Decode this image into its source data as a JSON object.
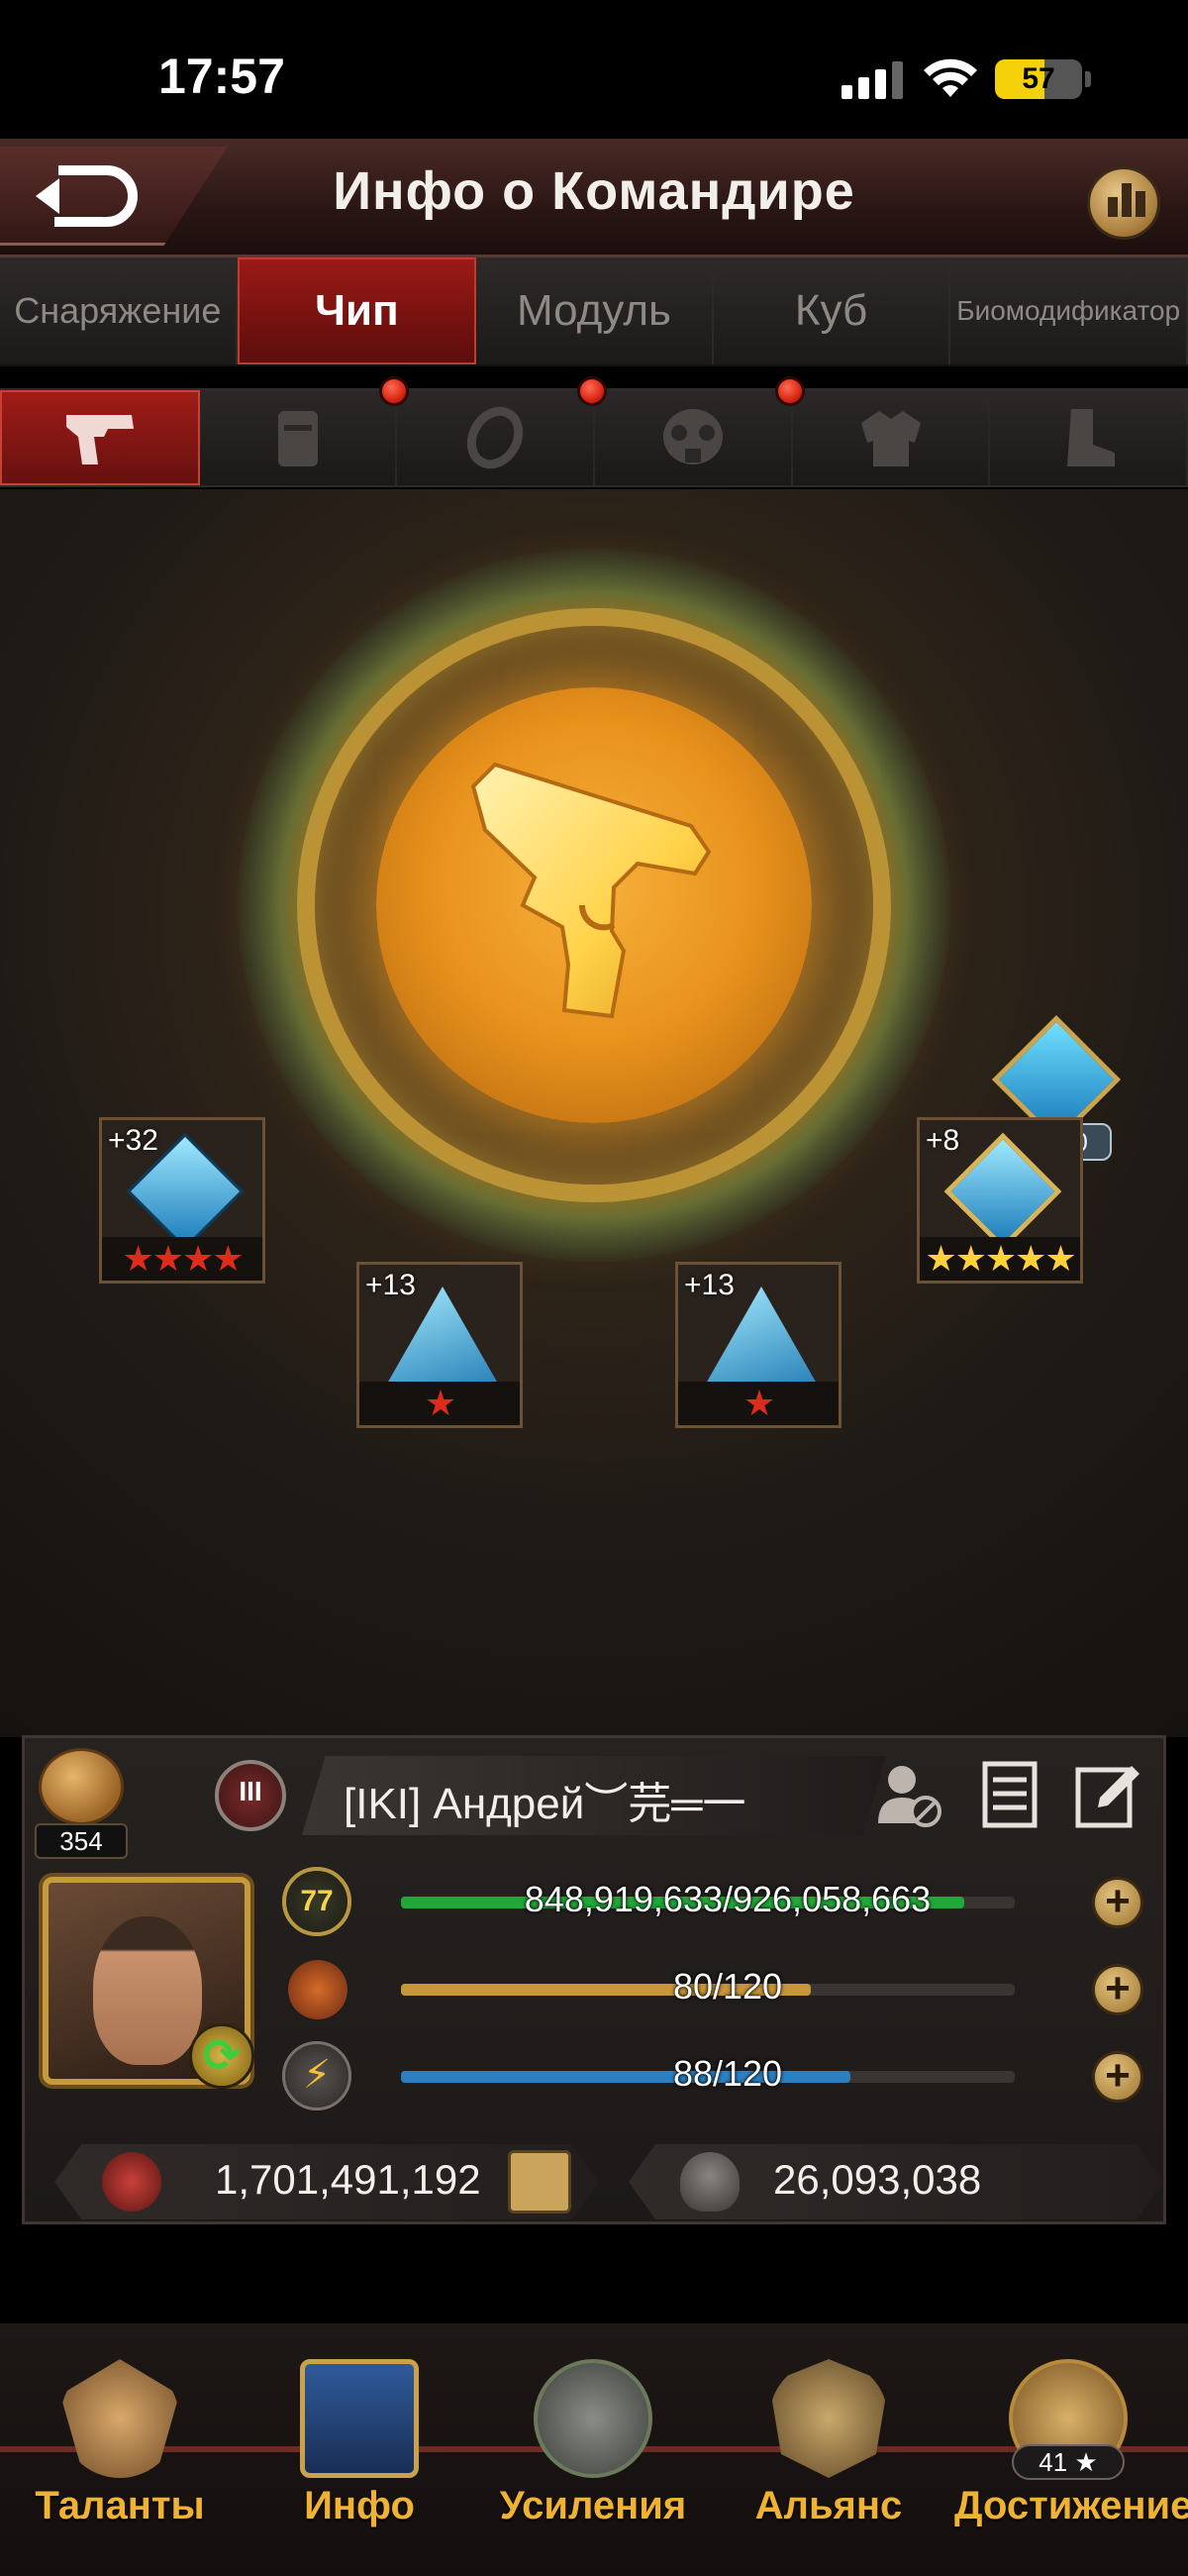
{
  "status_bar": {
    "time": "17:57",
    "battery": "57",
    "battery_level": 0.57
  },
  "header": {
    "title": "Инфо о Командире"
  },
  "main_tabs": [
    {
      "label": "Снаряжение",
      "active": false
    },
    {
      "label": "Чип",
      "active": true
    },
    {
      "label": "Модуль",
      "active": false
    },
    {
      "label": "Куб",
      "active": false
    },
    {
      "label": "Биомодификатор",
      "active": false
    }
  ],
  "sub_tabs": [
    {
      "icon": "pistol-icon",
      "active": true,
      "notification": false
    },
    {
      "icon": "vest-icon",
      "active": false,
      "notification": true
    },
    {
      "icon": "ring-icon",
      "active": false,
      "notification": true
    },
    {
      "icon": "gas-mask-icon",
      "active": false,
      "notification": true
    },
    {
      "icon": "armor-icon",
      "active": false,
      "notification": false
    },
    {
      "icon": "boot-icon",
      "active": false,
      "notification": false
    }
  ],
  "core": {
    "icon": "pistol-icon",
    "level_label": "Lv.20"
  },
  "chips": [
    {
      "name": "chip-slot-top-left",
      "plus": "+32",
      "stars": 4,
      "star_color": "red",
      "shape": "diamond"
    },
    {
      "name": "chip-slot-top-right",
      "plus": "+8",
      "stars": 5,
      "star_color": "gold",
      "shape": "diamond"
    },
    {
      "name": "chip-slot-bottom-left",
      "plus": "+13",
      "stars": 1,
      "star_color": "red",
      "shape": "triangle"
    },
    {
      "name": "chip-slot-bottom-right",
      "plus": "+13",
      "stars": 1,
      "star_color": "red",
      "shape": "triangle"
    }
  ],
  "profile": {
    "rank_count": "354",
    "alliance_rank": "III",
    "name": "[IKI]  Андрей︶芫═一",
    "stats": [
      {
        "name": "experience",
        "icon": "level-77-icon",
        "level": "77",
        "text": "848,919,633/926,058,663",
        "fill": 0.917,
        "color": "#21a83a"
      },
      {
        "name": "stamina",
        "icon": "stamina-capsule-icon",
        "text": "80/120",
        "fill": 0.667,
        "color": "#c79636"
      },
      {
        "name": "energy",
        "icon": "energy-bolt-icon",
        "text": "88/120",
        "fill": 0.733,
        "color": "#2b80c2"
      }
    ],
    "power": "1,701,491,192",
    "kills": "26,093,038"
  },
  "bottom_nav": [
    {
      "label": "Таланты",
      "icon": "talents-eagle-icon"
    },
    {
      "label": "Инфо",
      "icon": "info-book-icon"
    },
    {
      "label": "Усиления",
      "icon": "boost-hammer-icon"
    },
    {
      "label": "Альянс",
      "icon": "alliance-swords-icon"
    },
    {
      "label": "Достижение",
      "icon": "achievement-lion-icon",
      "badge": "41 ★"
    }
  ]
}
